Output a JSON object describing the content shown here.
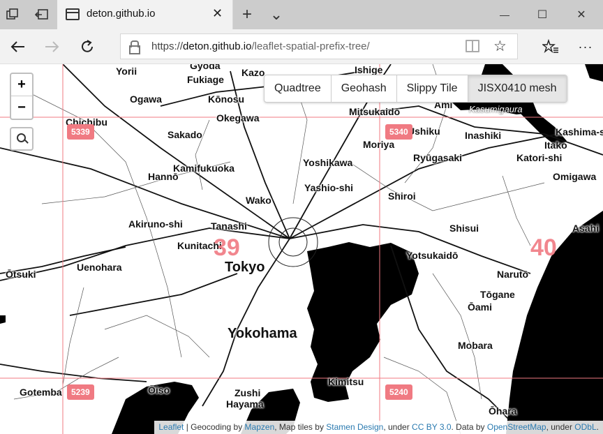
{
  "window": {
    "tab_title": "deton.github.io",
    "new_tab_symbol": "+",
    "tab_list_symbol": "⌄",
    "minimize_symbol": "—",
    "maximize_symbol": "☐",
    "close_symbol": "✕"
  },
  "address_bar": {
    "url_scheme": "https://",
    "url_host": "deton.github.io",
    "url_path": "/leaflet-spatial-prefix-tree/"
  },
  "map": {
    "zoom_in_label": "+",
    "zoom_out_label": "−",
    "layer_buttons": [
      "Quadtree",
      "Geohash",
      "Slippy Tile",
      "JISX0410 mesh"
    ],
    "active_layer": "JISX0410 mesh",
    "mesh_labels": [
      "5339",
      "5340",
      "5239",
      "5240"
    ],
    "big_mesh_labels": [
      "39",
      "40"
    ],
    "mesh_color": "#f07a82",
    "places": [
      "Yorii",
      "Gyoda",
      "Fukiage",
      "Kazo",
      "Ishige",
      "Ogawa",
      "Kōnosu",
      "Mitsukaidō",
      "Ami",
      "Kasumigaura",
      "Chichibu",
      "Okegawa",
      "Ushiku",
      "Inashiki",
      "Kashima-shi",
      "Sakado",
      "Moriya",
      "Itako",
      "Ryūgasaki",
      "Katori-shi",
      "Kamifukuoka",
      "Yoshikawa",
      "Omigawa",
      "Hannō",
      "Yashio-shi",
      "Wako",
      "Shiroi",
      "Akiruno-shi",
      "Tanashi",
      "Shisui",
      "Asahi",
      "Kunitachi",
      "Tokyo",
      "Yotsukaidō",
      "Uenohara",
      "Ōtsuki",
      "Narutō",
      "Tōgane",
      "Ōami",
      "Yokohama",
      "Mobara",
      "Kimitsu",
      "Gotemba",
      "Ōiso",
      "Zushi",
      "Hayama",
      "Ōhara"
    ]
  },
  "attribution": {
    "leaflet": "Leaflet",
    "text1": " | Geocoding by ",
    "mapzen": "Mapzen",
    "text2": ", Map tiles by ",
    "stamen": "Stamen Design",
    "text3": ", under ",
    "ccby": "CC BY 3.0",
    "text4": ". Data by ",
    "osm": "OpenStreetMap",
    "text5": ", under ",
    "odbl": "ODbL",
    "text6": "."
  },
  "icons": [
    "tab-actions-icon",
    "back-tabs-icon",
    "page-icon",
    "back-arrow-icon",
    "forward-arrow-icon",
    "refresh-icon",
    "lock-icon",
    "reading-view-icon",
    "favorite-star-icon",
    "favorites-list-icon",
    "more-icon",
    "search-icon"
  ]
}
